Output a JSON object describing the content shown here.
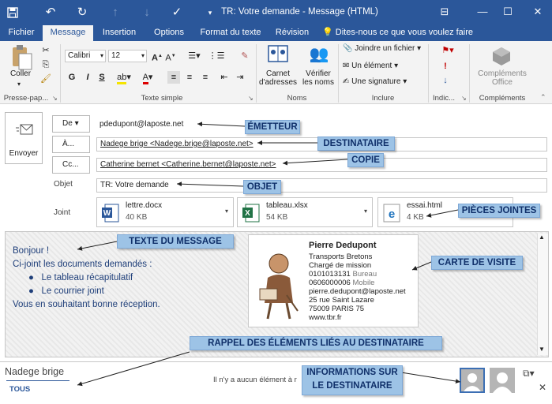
{
  "titlebar": {
    "title": "TR: Votre demande - Message (HTML)",
    "icons": [
      "save-icon",
      "undo-icon",
      "redo-icon",
      "up-arrow-icon",
      "down-arrow-icon",
      "check-icon",
      "customize-icon"
    ],
    "restore_glyph": "⊟",
    "minimize_glyph": "—",
    "maximize_glyph": "☐",
    "close_glyph": "✕"
  },
  "tabs": [
    "Fichier",
    "Message",
    "Insertion",
    "Options",
    "Format du texte",
    "Révision",
    "Dites-nous ce que vous voulez faire"
  ],
  "ribbon": {
    "paste": "Coller",
    "font": "Calibri",
    "size": "12",
    "bold": "G",
    "italic": "I",
    "underline": "S",
    "address_book": "Carnet d'adresses",
    "check_names": "Vérifier les noms",
    "attach_file": "Joindre un fichier",
    "attach_item": "Un élément",
    "signature": "Une signature",
    "addins": "Compléments Office",
    "groups": {
      "clipboard": "Presse-pap...",
      "basic_text": "Texte simple",
      "names": "Noms",
      "include": "Inclure",
      "tags": "Indic...",
      "addins": "Compléments"
    }
  },
  "header": {
    "send": "Envoyer",
    "from_btn": "De",
    "from_value": "pdedupont@laposte.net",
    "to_btn": "À...",
    "to_value": "Nadege brige <Nadege.brige@laposte.net>",
    "cc_btn": "Cc...",
    "cc_value": "Catherine bernet <Catherine.bernet@laposte.net>",
    "subject_label": "Objet",
    "subject_value": "TR: Votre demande",
    "attach_label": "Joint",
    "attachments": [
      {
        "name": "lettre.docx",
        "size": "40 KB",
        "icon": "word-icon"
      },
      {
        "name": "tableau.xlsx",
        "size": "54 KB",
        "icon": "excel-icon"
      },
      {
        "name": "essai.html",
        "size": "4 KB",
        "icon": "edge-icon"
      }
    ]
  },
  "body": {
    "greeting": "Bonjour !",
    "intro": "Ci-joint les documents demandés :",
    "bullets": [
      "Le tableau récapitulatif",
      "Le courrier joint"
    ],
    "closing": "Vous en souhaitant bonne réception."
  },
  "vcard": {
    "name": "Pierre Dedupont",
    "company": "Transports Bretons",
    "title": "Chargé de mission",
    "phone1": "0101013131",
    "phone1_type": "Bureau",
    "phone2": "0606000006",
    "phone2_type": "Mobile",
    "email": "pierre.dedupont@laposte.net",
    "street": "25 rue Saint Lazare",
    "city": "75009  PARIS  75",
    "web": "www.tbr.fr"
  },
  "footer": {
    "recipient": "Nadege brige",
    "tab_all": "TOUS",
    "info": "Il n'y a aucun élément à r"
  },
  "annotations": {
    "emetteur": "ÉMETTEUR",
    "destinataire": "DESTINATAIRE",
    "copie": "COPIE",
    "objet": "OBJET",
    "pieces": "PIÈCES JOINTES",
    "texte": "TEXTE DU MESSAGE",
    "carte": "CARTE DE VISITE",
    "rappel": "RAPPEL DES ÉLÉMENTS LIÉS AU DESTINATAIRE",
    "infos_1": "INFORMATIONS SUR",
    "infos_2": "LE DESTINATAIRE"
  },
  "colors": {
    "accent": "#2b579a",
    "annotation": "#9dc3e6",
    "body_text": "#1f3f7a"
  }
}
